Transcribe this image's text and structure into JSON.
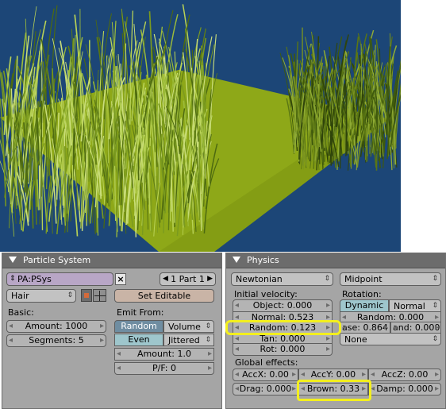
{
  "particle_system": {
    "header": "Particle System",
    "name_field": "PA:PSys",
    "part_selector": "1 Part 1",
    "type_menu": "Hair",
    "set_editable": "Set Editable",
    "basic_label": "Basic:",
    "amount": "Amount: 1000",
    "segments": "Segments: 5",
    "emit_from_label": "Emit From:",
    "random_toggle": "Random",
    "volume_menu": "Volume",
    "even_toggle": "Even",
    "jittered_menu": "Jittered",
    "amount2": "Amount: 1.0",
    "pf": "P/F: 0"
  },
  "physics": {
    "header": "Physics",
    "physics_menu": "Newtonian",
    "integrator_menu": "Midpoint",
    "initial_velocity_label": "Initial velocity:",
    "object": "Object: 0.000",
    "normal": "Normal: 0.523",
    "random": "Random: 0.123",
    "tan": "Tan: 0.000",
    "rot": "Rot: 0.000",
    "rotation_label": "Rotation:",
    "dynamic_toggle": "Dynamic",
    "rotation_menu": "Normal",
    "rot_random": "Random: 0.000",
    "phase": "ase: 0.864",
    "rand": "and: 0.000",
    "angular_menu": "None",
    "global_effects_label": "Global effects:",
    "accx": "AccX: 0.00",
    "accy": "AccY: 0.00",
    "accz": "AccZ: 0.00",
    "drag": "Drag: 0.000",
    "brown": "Brown: 0.33",
    "damp": "Damp: 0.000"
  },
  "colors": {
    "sky": "#1c4677",
    "ground": "#8ea818",
    "highlight": "#f3ef1e"
  }
}
